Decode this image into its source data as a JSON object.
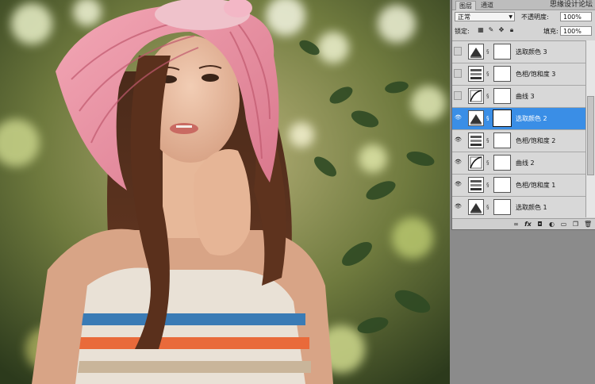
{
  "panel": {
    "tabs": [
      "图层",
      "通道"
    ],
    "watermark": "思缘设计论坛",
    "blend_mode": "正常",
    "opacity_label": "不透明度:",
    "opacity_value": "100%",
    "lock_label": "锁定:",
    "fill_label": "填充:",
    "fill_value": "100%",
    "lock_icons": [
      "lock-transparent-icon",
      "lock-brush-icon",
      "lock-move-icon",
      "lock-all-icon"
    ],
    "layers": [
      {
        "name": "选取颜色 3",
        "visible": false,
        "kind": "selective-color",
        "selected": false
      },
      {
        "name": "色相/饱和度 3",
        "visible": false,
        "kind": "hue-saturation",
        "selected": false
      },
      {
        "name": "曲线 3",
        "visible": false,
        "kind": "curves",
        "selected": false
      },
      {
        "name": "选取颜色 2",
        "visible": true,
        "kind": "selective-color",
        "selected": true
      },
      {
        "name": "色相/饱和度 2",
        "visible": true,
        "kind": "hue-saturation",
        "selected": false
      },
      {
        "name": "曲线 2",
        "visible": true,
        "kind": "curves",
        "selected": false
      },
      {
        "name": "色相/饱和度 1",
        "visible": true,
        "kind": "hue-saturation",
        "selected": false
      },
      {
        "name": "选取颜色 1",
        "visible": true,
        "kind": "selective-color",
        "selected": false
      }
    ],
    "bottom_icons": [
      "link-layers-icon",
      "fx-icon",
      "add-mask-icon",
      "adjustment-layer-icon",
      "group-folder-icon",
      "new-layer-icon",
      "trash-icon"
    ],
    "selected_color": "#3a8ee6"
  }
}
